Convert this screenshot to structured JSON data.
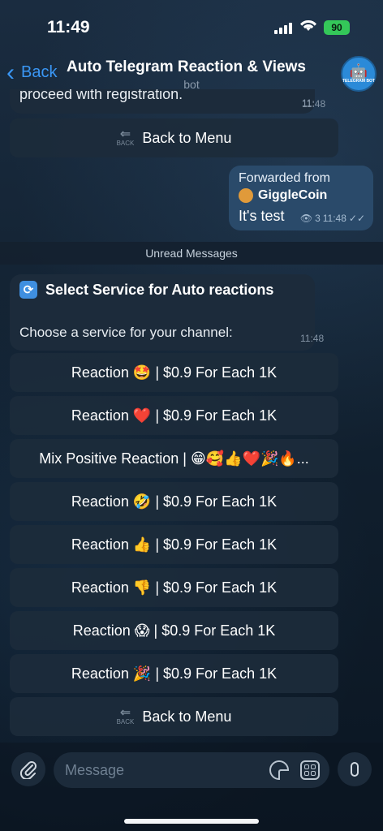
{
  "status_bar": {
    "time": "11:49",
    "battery": "90",
    "wifi_icon": "wifi-icon",
    "signal_icon": "cellular-signal-icon"
  },
  "header": {
    "back_label": "Back",
    "title": "Auto Telegram Reaction & Views",
    "subtitle": "bot",
    "avatar_text": "TELEGRAM BOT"
  },
  "messages": {
    "top_partial": {
      "text": "proceed with registration.",
      "time": "11:48"
    },
    "back_to_menu_1": "Back to Menu",
    "forwarded": {
      "forwarded_label": "Forwarded from",
      "from_name": "GiggleCoin",
      "text": "It's test",
      "views": "3",
      "time": "11:48"
    },
    "unread_label": "Unread Messages",
    "service_prompt": {
      "title": "Select Service for Auto reactions",
      "text": "Choose a service for your channel:",
      "time": "11:48"
    }
  },
  "keyboard": {
    "buttons": [
      "Reaction 🤩 | $0.9 For Each 1K",
      "Reaction ❤️ | $0.9 For Each 1K",
      "Mix Positive Reaction | 😁🥰👍❤️🎉🔥...",
      "Reaction 🤣 | $0.9 For Each 1K",
      "Reaction 👍 | $0.9 For Each 1K",
      "Reaction 👎 | $0.9 For Each 1K",
      "Reaction 😱 | $0.9 For Each 1K",
      "Reaction 🎉 | $0.9 For Each 1K"
    ],
    "back_to_menu": "Back to Menu",
    "back_icon_text": "BACK"
  },
  "input": {
    "placeholder": "Message"
  },
  "colors": {
    "accent": "#3a97f5",
    "bubble_in": "#1c2b3b",
    "bubble_out": "#2a4a6a",
    "battery": "#34c759"
  }
}
